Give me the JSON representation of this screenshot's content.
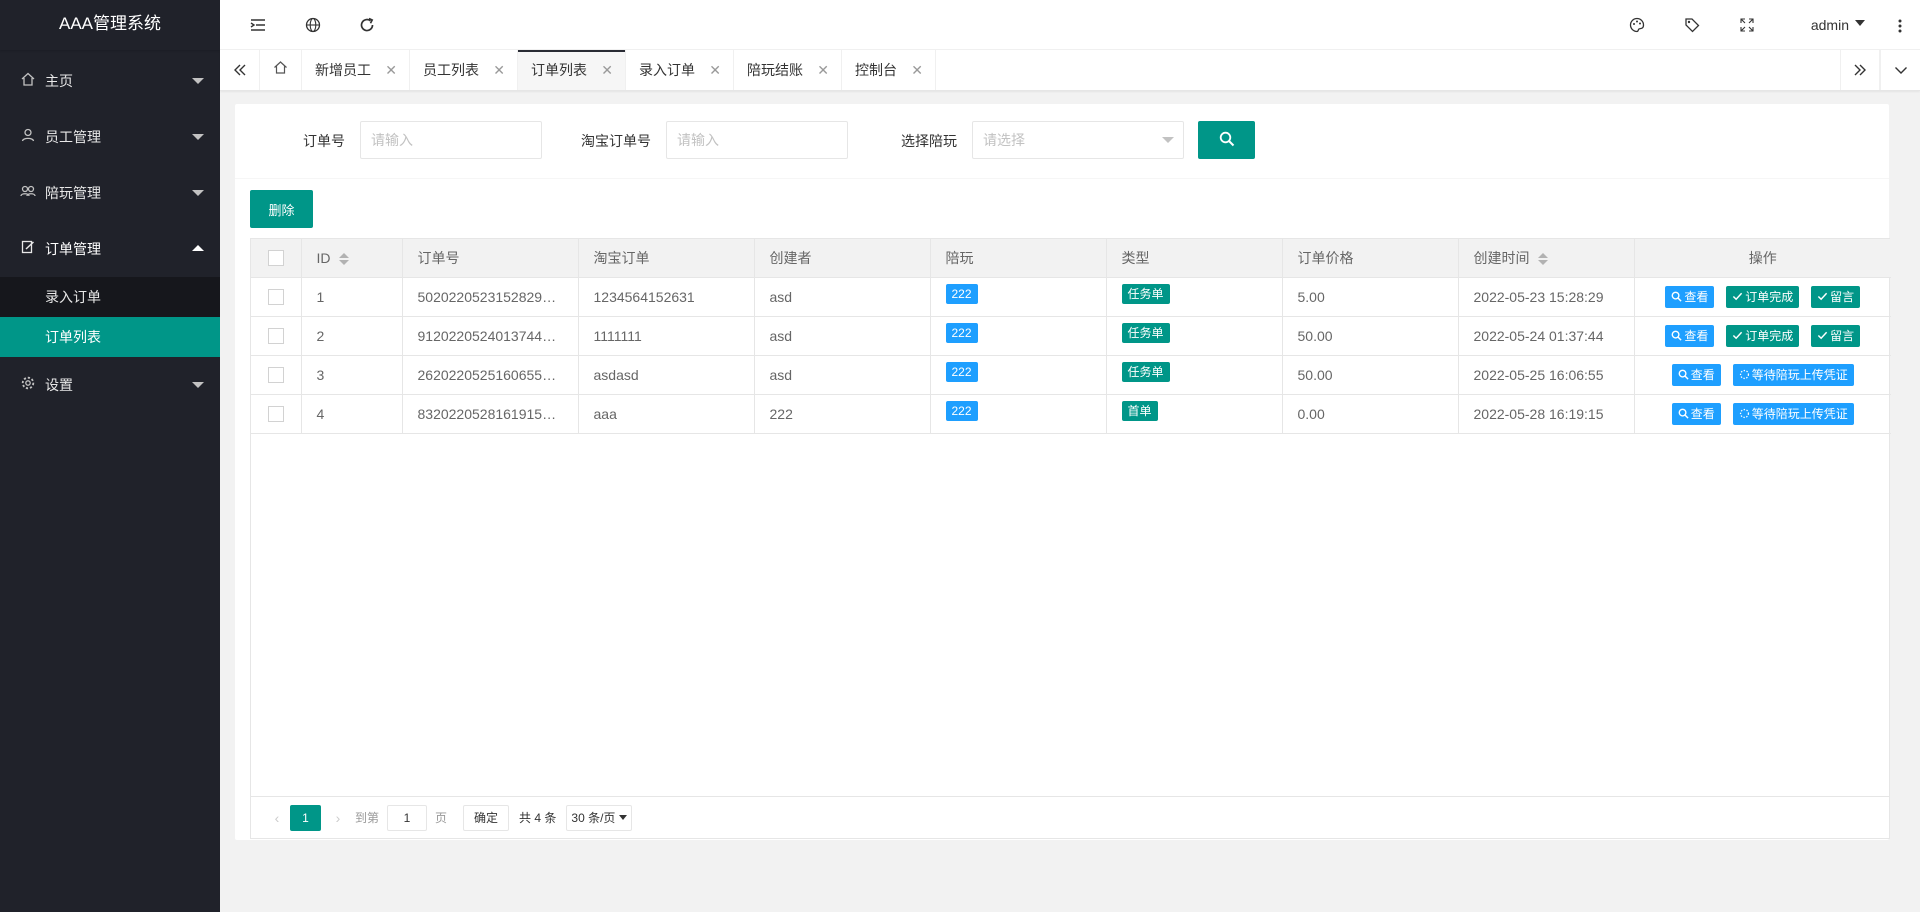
{
  "app": {
    "title": "AAA管理系统"
  },
  "sidebar": {
    "items": [
      {
        "label": "主页",
        "icon": "home-icon"
      },
      {
        "label": "员工管理",
        "icon": "user-icon"
      },
      {
        "label": "陪玩管理",
        "icon": "group-icon"
      },
      {
        "label": "订单管理",
        "icon": "edit-icon",
        "sub": [
          "录入订单",
          "订单列表"
        ]
      },
      {
        "label": "设置",
        "icon": "gear-icon"
      }
    ]
  },
  "header": {
    "user": "admin"
  },
  "tabs": [
    {
      "label": "新增员工"
    },
    {
      "label": "员工列表"
    },
    {
      "label": "订单列表"
    },
    {
      "label": "录入订单"
    },
    {
      "label": "陪玩结账"
    },
    {
      "label": "控制台"
    }
  ],
  "search": {
    "order_no_label": "订单号",
    "order_no_placeholder": "请输入",
    "taobao_label": "淘宝订单号",
    "taobao_placeholder": "请输入",
    "player_label": "选择陪玩",
    "player_placeholder": "请选择"
  },
  "toolbar": {
    "delete_label": "删除"
  },
  "table": {
    "headers": [
      "ID",
      "订单号",
      "淘宝订单",
      "创建者",
      "陪玩",
      "类型",
      "订单价格",
      "创建时间",
      "操作"
    ],
    "rows": [
      {
        "id": "1",
        "order_no": "5020220523152829…",
        "taobao": "1234564152631",
        "creator": "asd",
        "player": "222",
        "type": "任务单",
        "price": "5.00",
        "created": "2022-05-23 15:28:29",
        "actions": [
          "查看",
          "订单完成",
          "留言"
        ]
      },
      {
        "id": "2",
        "order_no": "9120220524013744…",
        "taobao": "1111111",
        "creator": "asd",
        "player": "222",
        "type": "任务单",
        "price": "50.00",
        "created": "2022-05-24 01:37:44",
        "actions": [
          "查看",
          "订单完成",
          "留言"
        ]
      },
      {
        "id": "3",
        "order_no": "2620220525160655…",
        "taobao": "asdasd",
        "creator": "asd",
        "player": "222",
        "type": "任务单",
        "price": "50.00",
        "created": "2022-05-25 16:06:55",
        "actions": [
          "查看",
          "等待陪玩上传凭证"
        ]
      },
      {
        "id": "4",
        "order_no": "8320220528161915…",
        "taobao": "aaa",
        "creator": "222",
        "player": "222",
        "type": "首单",
        "price": "0.00",
        "created": "2022-05-28 16:19:15",
        "actions": [
          "查看",
          "等待陪玩上传凭证"
        ]
      }
    ]
  },
  "pager": {
    "current": "1",
    "goto_label": "到第",
    "page_input": "1",
    "page_unit": "页",
    "confirm": "确定",
    "total": "共 4 条",
    "page_size": "30 条/页"
  },
  "colors": {
    "primary": "#009688",
    "info": "#1e9fff",
    "sidebar": "#20222a"
  }
}
